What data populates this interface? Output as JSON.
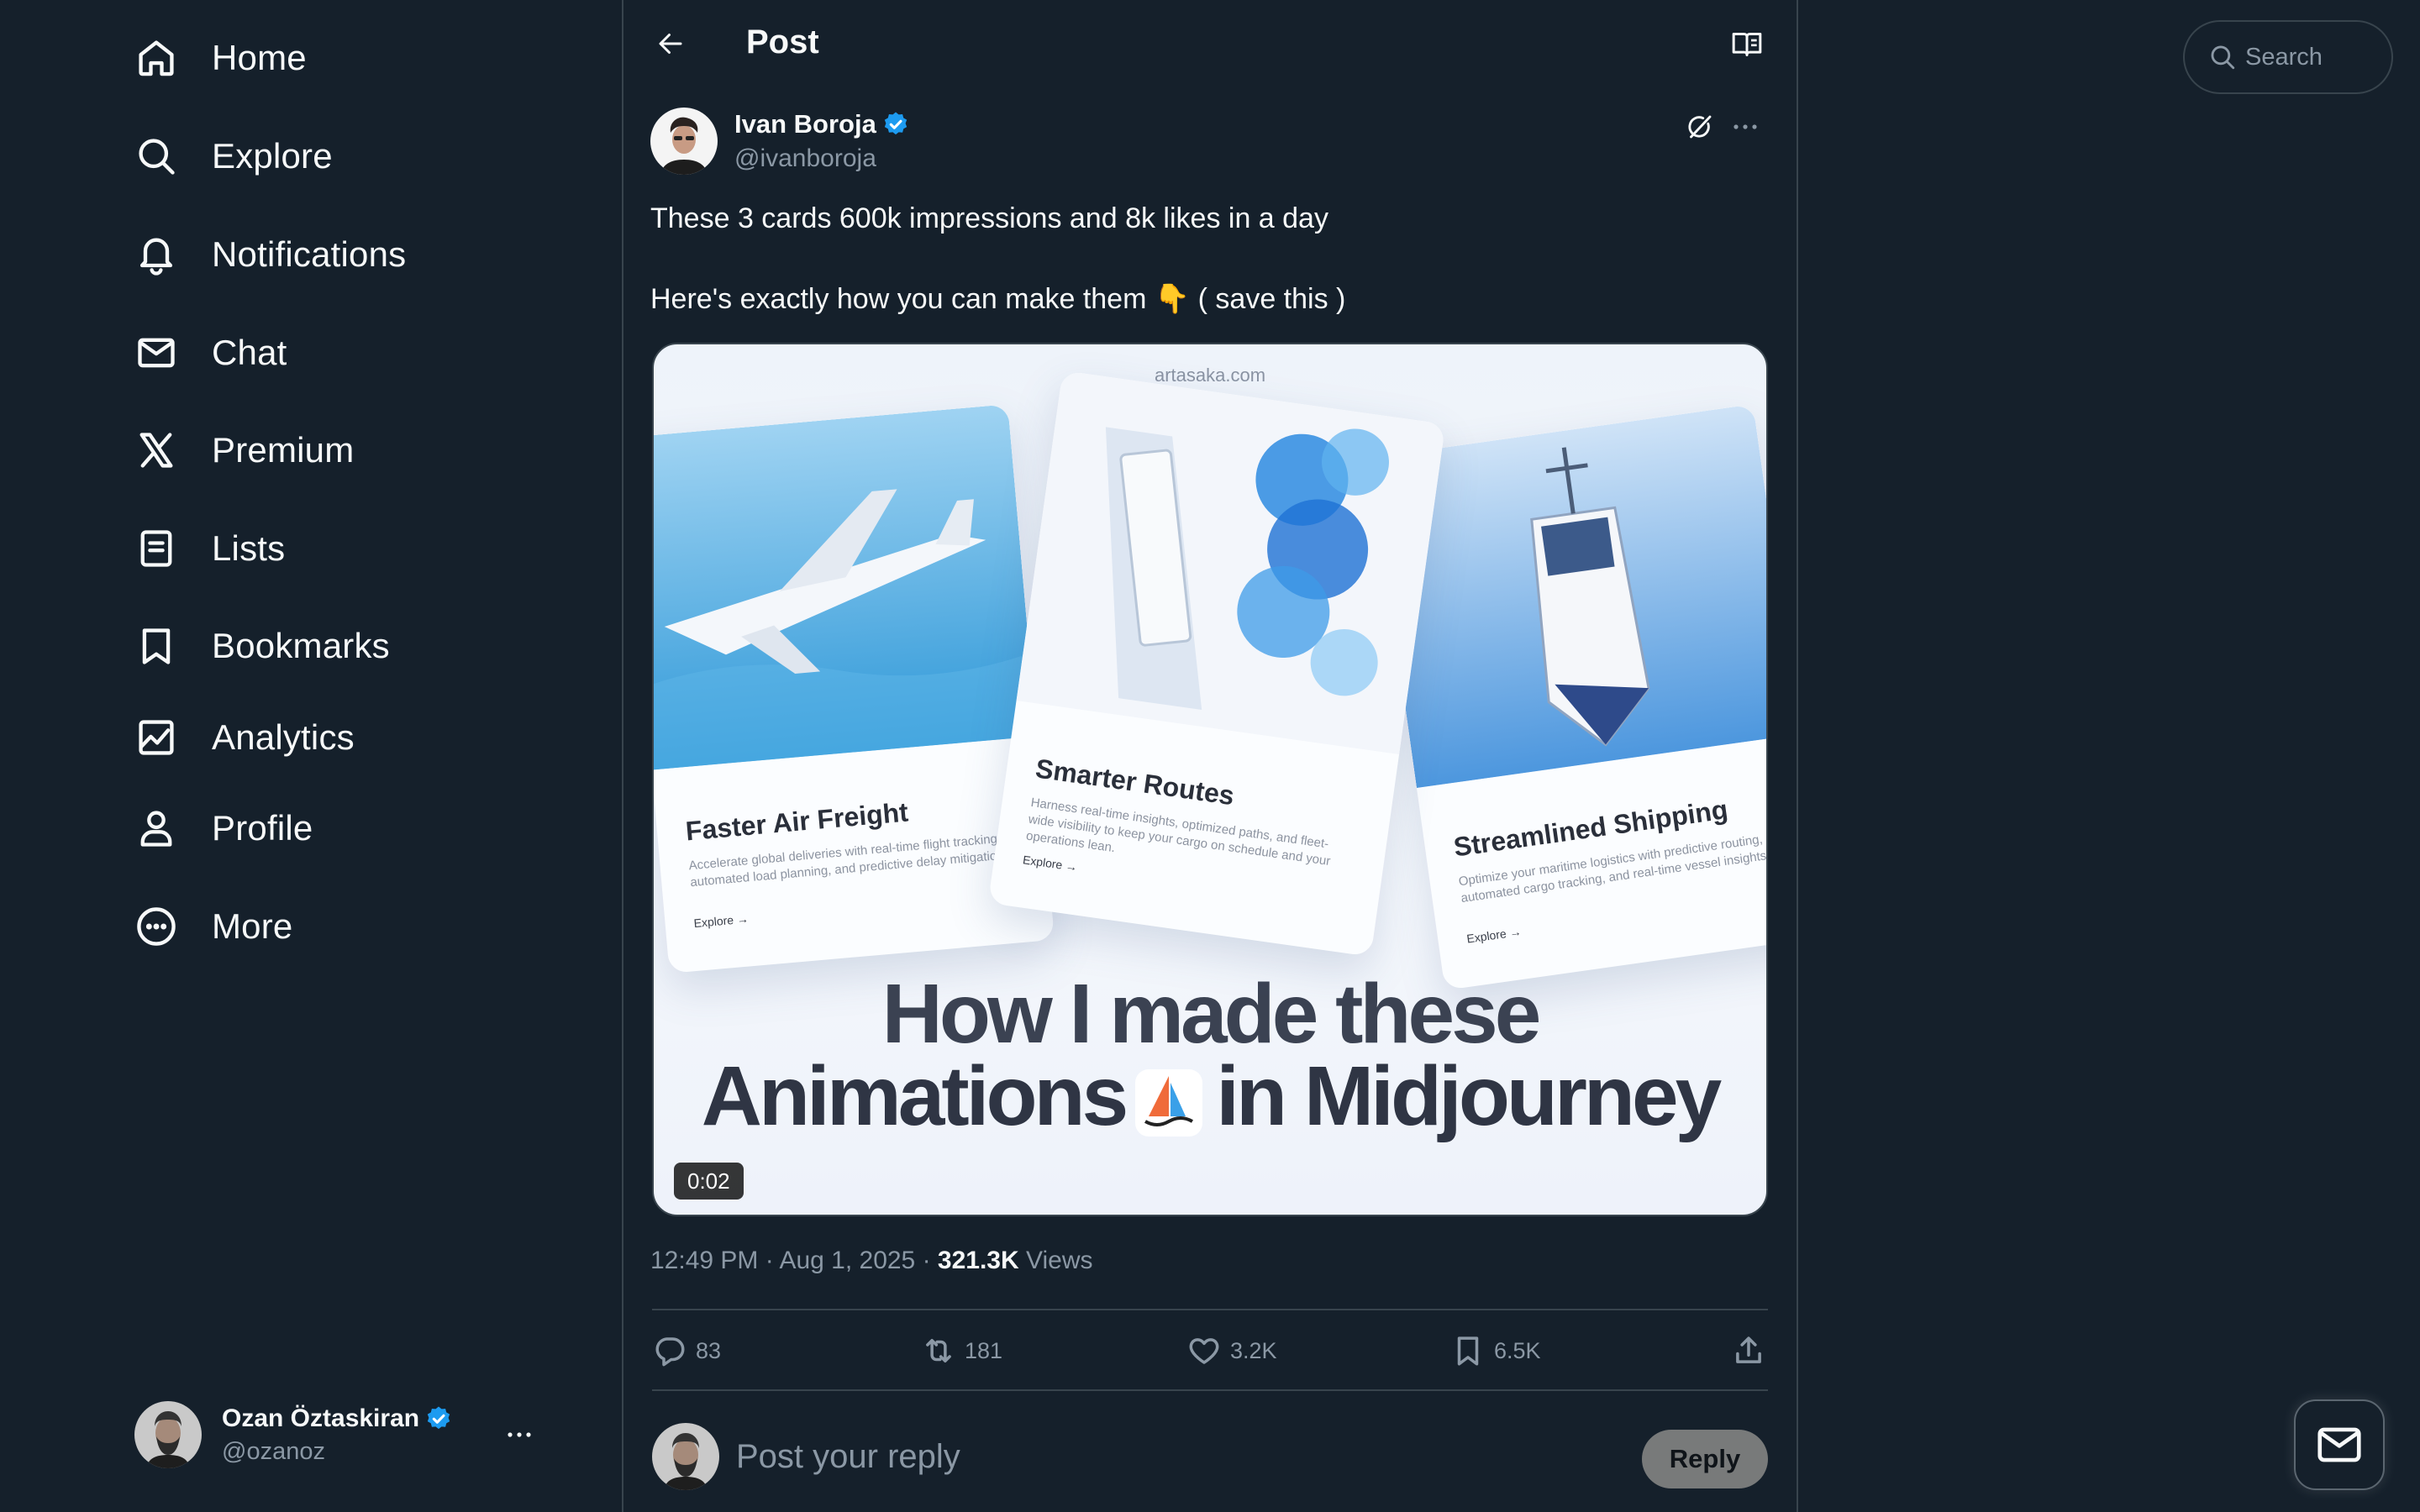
{
  "nav": {
    "items": [
      {
        "label": "Home",
        "icon": "home-icon"
      },
      {
        "label": "Explore",
        "icon": "search-icon"
      },
      {
        "label": "Notifications",
        "icon": "bell-icon"
      },
      {
        "label": "Chat",
        "icon": "envelope-icon"
      },
      {
        "label": "Premium",
        "icon": "x-logo-icon"
      },
      {
        "label": "Lists",
        "icon": "list-icon"
      },
      {
        "label": "Bookmarks",
        "icon": "bookmark-icon"
      },
      {
        "label": "Analytics",
        "icon": "analytics-icon"
      },
      {
        "label": "Profile",
        "icon": "person-icon"
      },
      {
        "label": "More",
        "icon": "more-circle-icon"
      }
    ]
  },
  "account": {
    "name": "Ozan Öztaskiran",
    "handle": "@ozanoz",
    "verified": true
  },
  "header": {
    "title": "Post"
  },
  "post": {
    "author": {
      "name": "Ivan Boroja",
      "handle": "@ivanboroja",
      "verified": true
    },
    "text_lines": [
      "These 3 cards 600k impressions and 8k likes in a day",
      "Here's exactly how you can make them 👇 ( save this )"
    ],
    "media": {
      "source": "artasaka.com",
      "cards": [
        {
          "title": "Faster Air Freight",
          "desc": "Accelerate global deliveries with real-time flight tracking, automated load planning, and predictive delay mitigation.",
          "link": "Explore →"
        },
        {
          "title": "Smarter Routes",
          "desc": "Harness real-time insights, optimized paths, and fleet-wide visibility to keep your cargo on schedule and your operations lean.",
          "link": "Explore →"
        },
        {
          "title": "Streamlined Shipping",
          "desc": "Optimize your maritime logistics with predictive routing, automated cargo tracking, and real-time vessel insights.",
          "link": "Explore →"
        }
      ],
      "headline_line1": "How I made these",
      "headline_line2_a": "Animations",
      "headline_line2_b": "in Midjourney",
      "duration": "0:02"
    },
    "time": "12:49 PM",
    "date": "Aug 1, 2025",
    "views_count": "321.3K",
    "views_label": "Views",
    "stats": {
      "replies": "83",
      "reposts": "181",
      "likes": "3.2K",
      "bookmarks": "6.5K"
    }
  },
  "reply": {
    "placeholder": "Post your reply",
    "button": "Reply"
  },
  "search": {
    "placeholder": "Search"
  },
  "colors": {
    "background": "#15202b",
    "border": "#38444d",
    "muted": "#8b98a5",
    "verified": "#1d9bf0",
    "text": "#f7f9f9"
  }
}
